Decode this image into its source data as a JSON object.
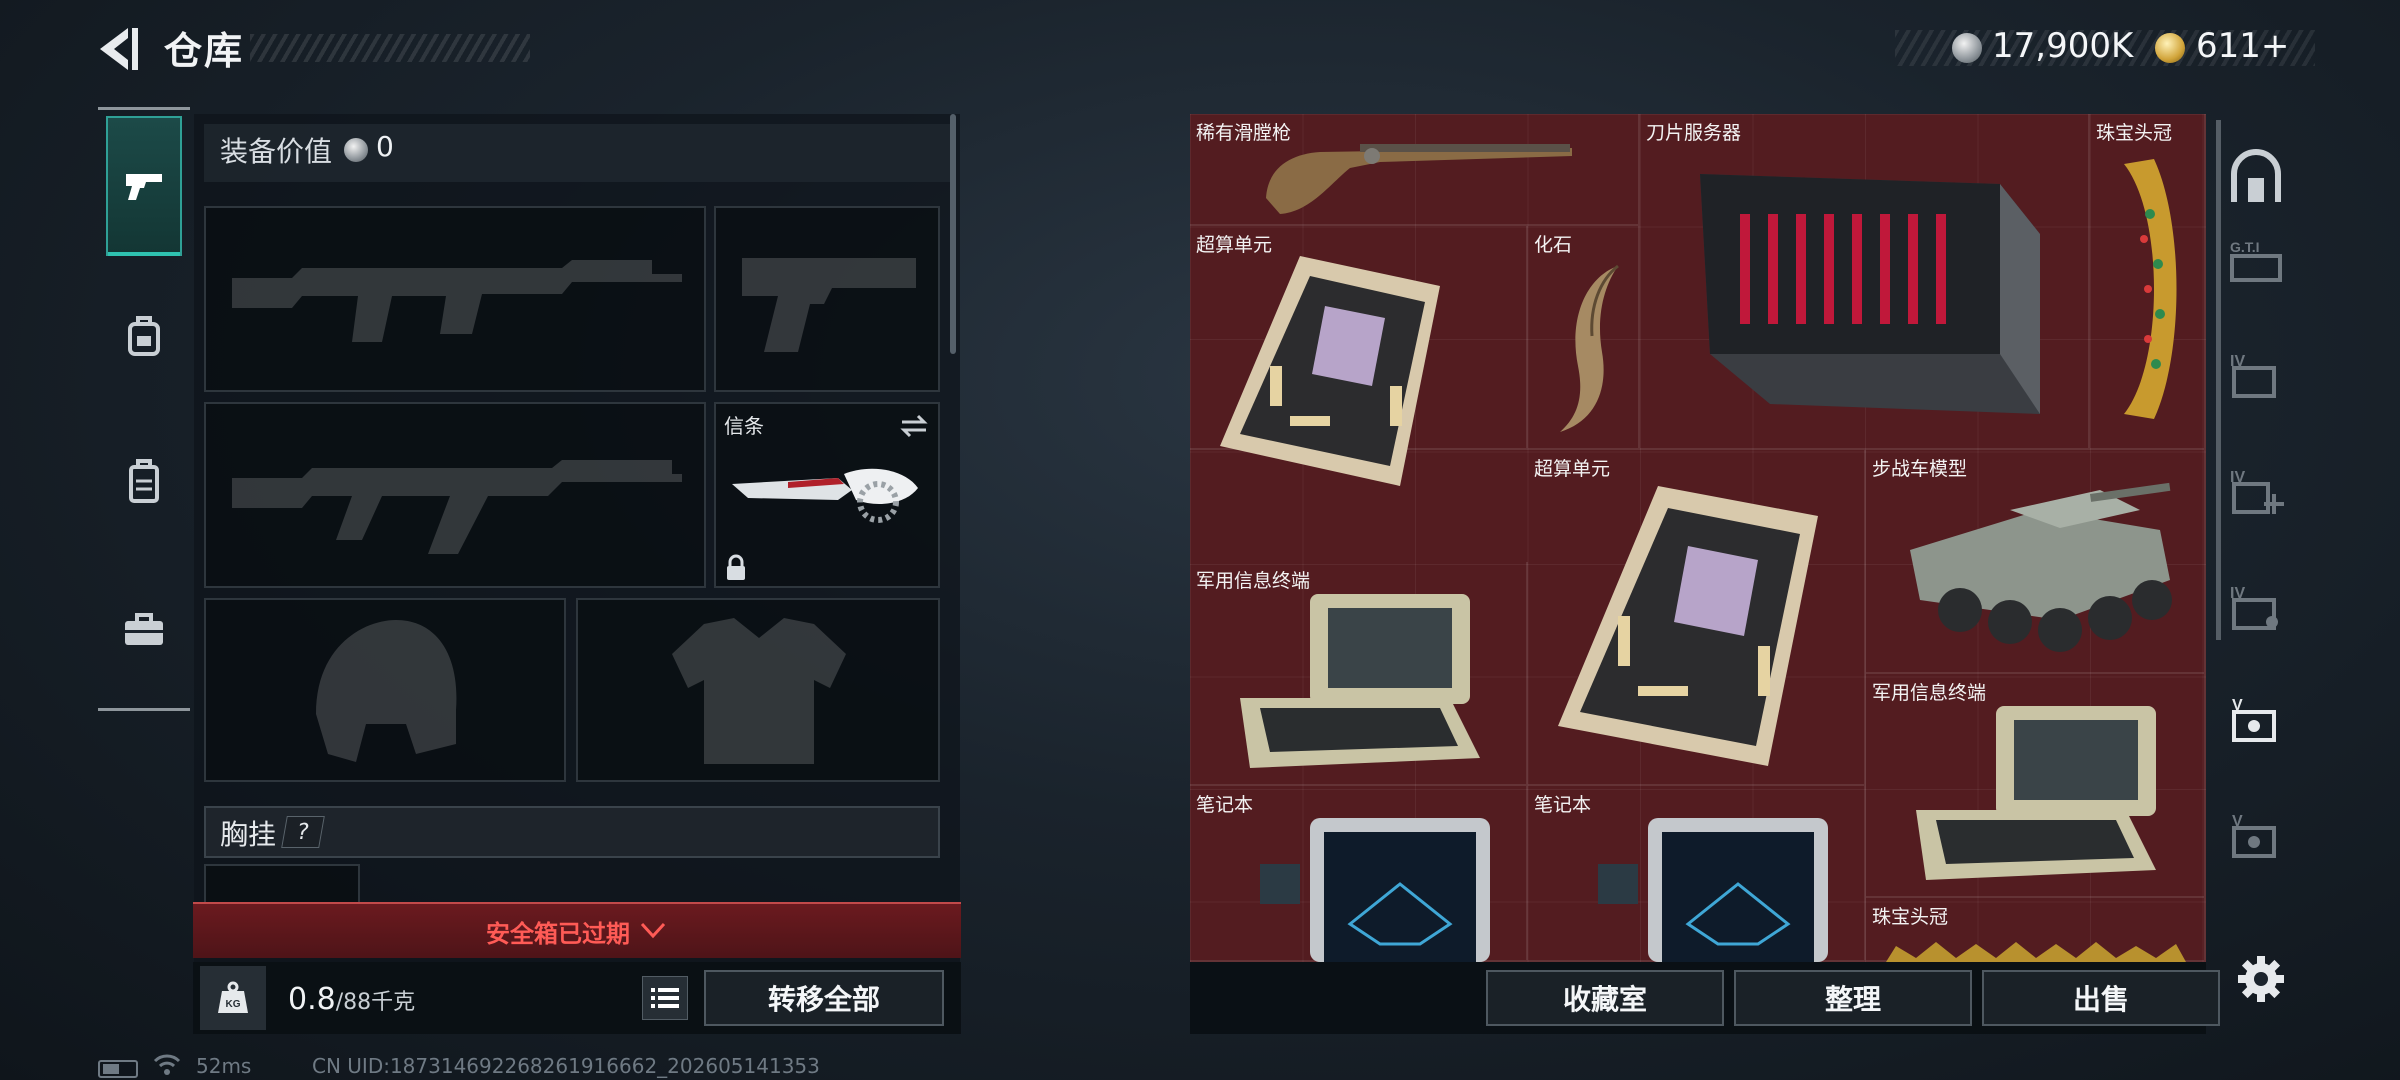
{
  "header": {
    "title": "仓库",
    "currency": {
      "silver": "17,900K",
      "gold": "611+"
    }
  },
  "sidebar": {
    "items": [
      {
        "name": "weapons",
        "active": true,
        "icon": "pistol-icon"
      },
      {
        "name": "gear",
        "active": false,
        "icon": "backpack-icon"
      },
      {
        "name": "armor",
        "active": false,
        "icon": "vest-icon"
      },
      {
        "name": "cases",
        "active": false,
        "icon": "briefcase-icon"
      }
    ]
  },
  "loadout": {
    "equip_value_label": "装备价值",
    "equip_value": "0",
    "slots": [
      {
        "type": "rifle"
      },
      {
        "type": "pistol"
      },
      {
        "type": "rifle"
      },
      {
        "type": "melee",
        "label": "信条",
        "locked": true
      },
      {
        "type": "helmet"
      },
      {
        "type": "armor"
      }
    ],
    "chest_label": "胸挂",
    "help": "?",
    "expired_text": "安全箱已过期",
    "weight": "0.8",
    "weight_unit": "/88千克",
    "kg_icon_text": "KG",
    "transfer_label": "转移全部"
  },
  "storage": {
    "items": [
      {
        "name": "稀有滑膛枪",
        "icon": "musket-icon"
      },
      {
        "name": "刀片服务器",
        "icon": "server-icon"
      },
      {
        "name": "珠宝头冠",
        "icon": "crown-icon"
      },
      {
        "name": "超算单元",
        "icon": "circuit-board-icon"
      },
      {
        "name": "化石",
        "icon": "fossil-claw-icon"
      },
      {
        "name": "超算单元",
        "icon": "circuit-board-icon"
      },
      {
        "name": "步战车模型",
        "icon": "ifv-model-icon"
      },
      {
        "name": "军用信息终端",
        "icon": "military-terminal-icon"
      },
      {
        "name": "军用信息终端",
        "icon": "military-terminal-icon"
      },
      {
        "name": "笔记本",
        "icon": "laptop-icon"
      },
      {
        "name": "笔记本",
        "icon": "laptop-icon"
      },
      {
        "name": "珠宝头冠",
        "icon": "crown-icon"
      }
    ],
    "buttons": {
      "collection": "收藏室",
      "sort": "整理",
      "sell": "出售"
    }
  },
  "right_rail": {
    "items": [
      {
        "label": "",
        "icon": "vault-icon"
      },
      {
        "label": "G.T.I",
        "icon": "gti-storage-icon"
      },
      {
        "label": "IV",
        "icon": "storage-iv-icon"
      },
      {
        "label": "IV",
        "icon": "storage-iv-plus-icon"
      },
      {
        "label": "IV",
        "icon": "storage-iv-key-icon"
      },
      {
        "label": "V",
        "icon": "storage-v-icon"
      },
      {
        "label": "V",
        "icon": "storage-v-key-icon"
      }
    ]
  },
  "status": {
    "ping": "52ms",
    "uid": "CN UID:18731469226826191666​2_202605141353"
  },
  "colors": {
    "accent": "#2fc2b0",
    "storage_bg": "#531c20",
    "expired": "#ff5b56"
  }
}
